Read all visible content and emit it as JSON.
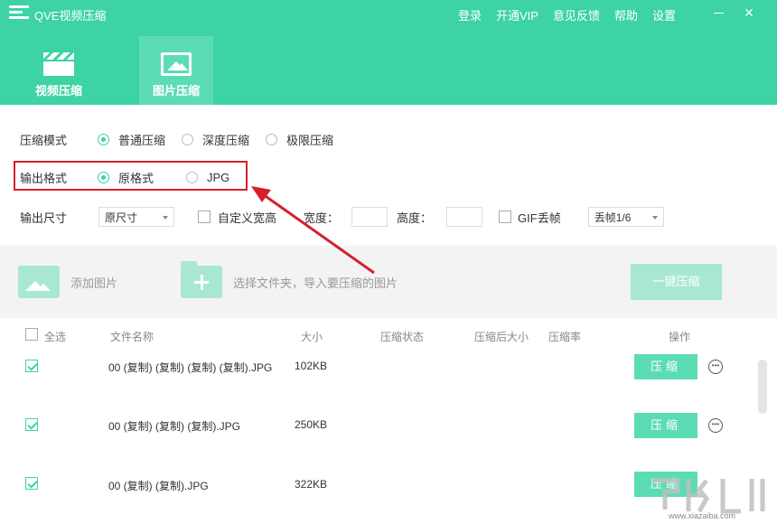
{
  "app": {
    "title": "QVE视频压缩"
  },
  "top_menu": [
    "登录",
    "开通VIP",
    "意见反馈",
    "帮助",
    "设置"
  ],
  "window_controls": {
    "close": "×"
  },
  "nav": [
    {
      "label": "视频压缩",
      "icon": "clapperboard-icon",
      "active": false
    },
    {
      "label": "图片压缩",
      "icon": "image-icon",
      "active": true
    }
  ],
  "options": {
    "mode": {
      "label": "压缩模式",
      "choices": [
        "普通压缩",
        "深度压缩",
        "极限压缩"
      ],
      "selected": "普通压缩"
    },
    "format": {
      "label": "输出格式",
      "choices": [
        "原格式",
        "JPG"
      ],
      "selected": "原格式"
    },
    "size": {
      "label": "输出尺寸",
      "select_value": "原尺寸",
      "custom_label": "自定义宽高",
      "width_label": "宽度：",
      "height_label": "高度：",
      "gif_label": "GIF丢帧",
      "gif_select_value": "丢帧1/6"
    }
  },
  "toolbar": {
    "add_image": "添加图片",
    "add_folder": "选择文件夹，导入要压缩的图片",
    "compress_all": "一键压缩"
  },
  "table": {
    "headers": {
      "select_all": "全选",
      "name": "文件名称",
      "size": "大小",
      "status": "压缩状态",
      "after": "压缩后大小",
      "ratio": "压缩率",
      "action": "操作"
    },
    "rows": [
      {
        "name": "00 (复制) (复制) (复制) (复制).JPG",
        "size": "102KB",
        "checked": true,
        "action": "压缩"
      },
      {
        "name": "00 (复制) (复制) (复制).JPG",
        "size": "250KB",
        "checked": true,
        "action": "压缩"
      },
      {
        "name": "00 (复制) (复制).JPG",
        "size": "322KB",
        "checked": true,
        "action": "压缩"
      }
    ]
  },
  "watermark": {
    "text": "www.xiazaiba.com"
  },
  "colors": {
    "accent": "#3dd3a4",
    "accent_light": "#a8e8d2",
    "annotation": "#d42128"
  }
}
